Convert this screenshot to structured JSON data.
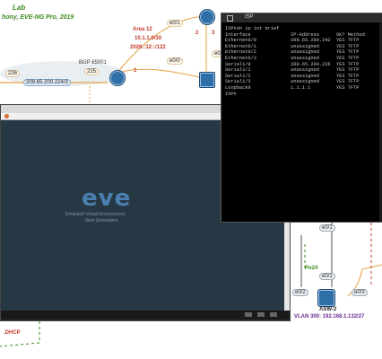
{
  "topology": {
    "title_line1": "Lab",
    "title_line2": "hony, EVE-NG Pro, 2019",
    "bgp_label": "BGP 65001",
    "area_label": [
      "Area 12",
      "10.1.1.0/30",
      "2026::12::/122"
    ],
    "link_label_left": "209.65.200.224/3",
    "if_labels": [
      "226",
      "225",
      "e0/1",
      "e0/0",
      "e0/2"
    ],
    "red_numbers": [
      "1",
      "2",
      "3"
    ],
    "po_label": "Po24",
    "switch_label": "ASW-2",
    "vlan_label": "VLAN 300: 192.168.1.132/27",
    "dhcp_label": ".DHCP",
    "port_labels": [
      "e0/1",
      "e0/1",
      "e0/2",
      "e0/3"
    ]
  },
  "isp_window": {
    "title": "ISP",
    "terminal_lines": [
      "ISP#sh ip int brief",
      "Interface              IP-Address      OK? Method",
      "Ethernet0/0            209.65.200.242  YES TFTP",
      "Ethernet0/1            unassigned      YES TFTP",
      "Ethernet0/2            unassigned      YES TFTP",
      "Ethernet0/3            unassigned      YES TFTP",
      "Serial1/0              209.65.200.226  YES TFTP",
      "Serial1/1              unassigned      YES TFTP",
      "Serial1/2              unassigned      YES TFTP",
      "Serial1/3              unassigned      YES TFTP",
      "Loopback0              1.1.1.1         YES TFTP",
      "ISP#"
    ]
  },
  "eve_window": {
    "logo": "eve",
    "subtitle1": "Emulated Virtual Environment",
    "subtitle2": "Next Generation"
  },
  "colors": {
    "terminal_bg": "#000000",
    "terminal_fg": "#c8c8c8",
    "eve_bg": "#273845",
    "topology_green": "#3c8a1e",
    "link_orange": "#e8a03c",
    "area_red": "#c0392b"
  }
}
